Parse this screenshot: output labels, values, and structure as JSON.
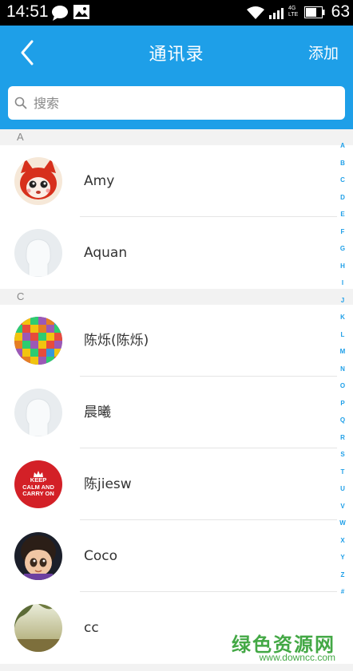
{
  "status": {
    "time": "14:51",
    "battery": "63",
    "network": "4G LTE"
  },
  "header": {
    "title": "通讯录",
    "add_label": "添加"
  },
  "search": {
    "placeholder": "搜索"
  },
  "sections": [
    {
      "letter": "A",
      "contacts": [
        {
          "name": "Amy",
          "avatar": "fox-avatar"
        },
        {
          "name": "Aquan",
          "avatar": "default-avatar"
        }
      ]
    },
    {
      "letter": "C",
      "contacts": [
        {
          "name": "陈烁(陈烁)",
          "avatar": "colorful-blocks-avatar"
        },
        {
          "name": "晨曦",
          "avatar": "default-avatar"
        },
        {
          "name": "陈jiesw",
          "avatar": "keep-calm-avatar",
          "avatar_text": "KEEP CALM AND CARRY ON"
        },
        {
          "name": "Coco",
          "avatar": "cartoon-girl-avatar"
        },
        {
          "name": "cc",
          "avatar": "landscape-avatar"
        }
      ]
    }
  ],
  "index_letters": [
    "A",
    "B",
    "C",
    "D",
    "E",
    "F",
    "G",
    "H",
    "I",
    "J",
    "K",
    "L",
    "M",
    "N",
    "O",
    "P",
    "Q",
    "R",
    "S",
    "T",
    "U",
    "V",
    "W",
    "X",
    "Y",
    "Z",
    "#"
  ],
  "watermark": {
    "text": "绿色资源网",
    "url": "www.downcc.com"
  },
  "colors": {
    "accent": "#1e9fe8",
    "watermark": "#43a845"
  }
}
